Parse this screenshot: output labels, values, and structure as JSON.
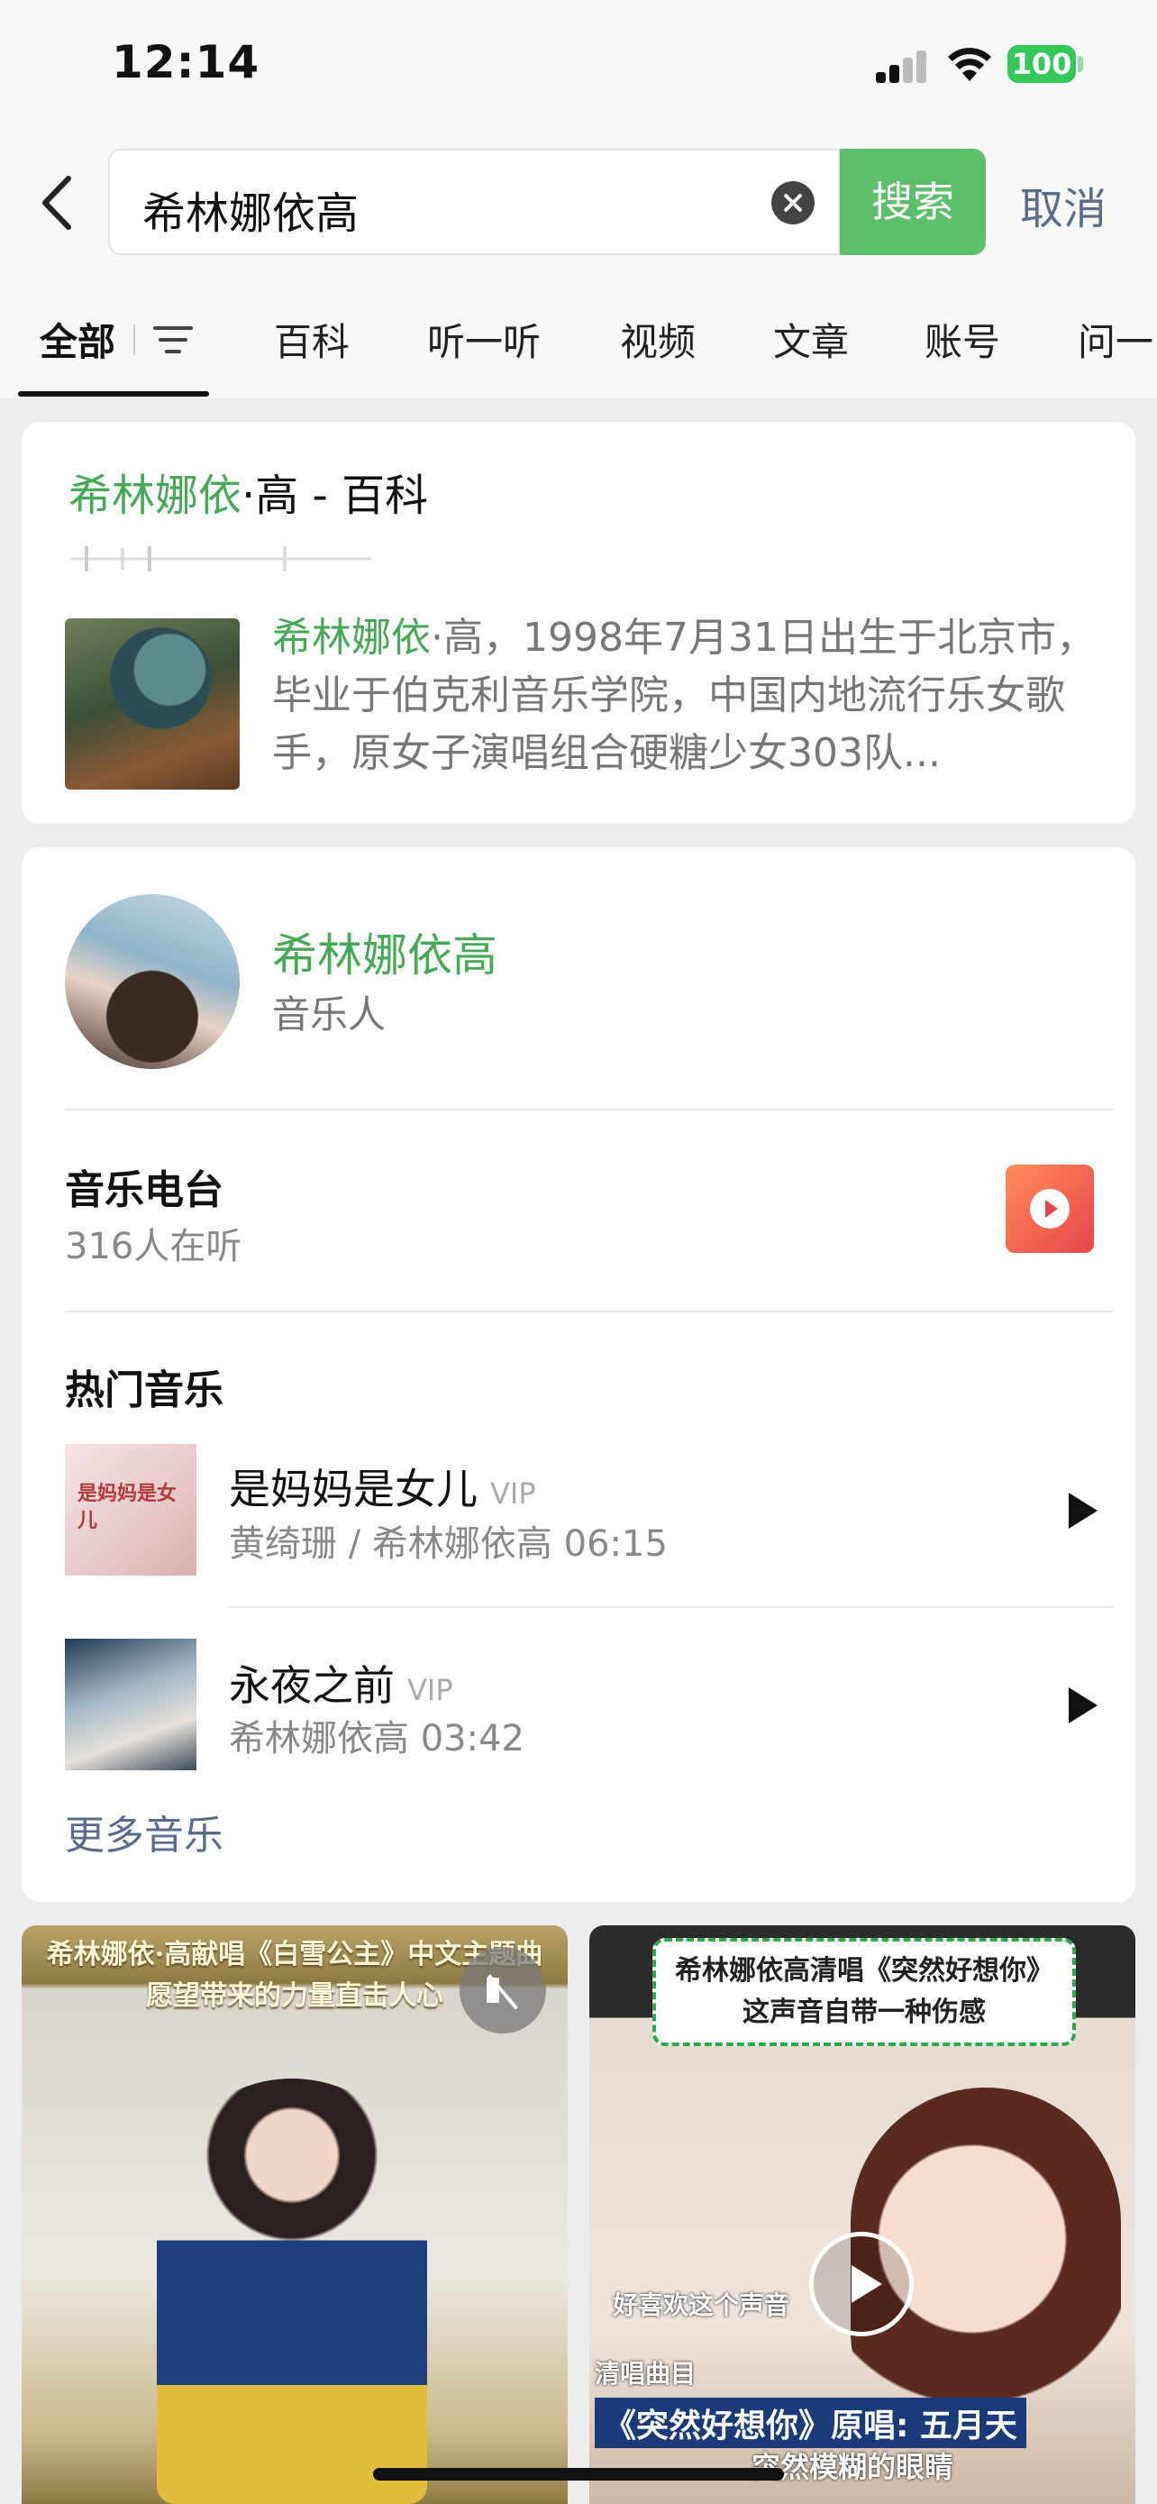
{
  "status_bar": {
    "time": "12:14",
    "battery": "100"
  },
  "search": {
    "query": "希林娜依高",
    "button": "搜索",
    "cancel": "取消"
  },
  "tabs": [
    "全部",
    "百科",
    "听一听",
    "视频",
    "文章",
    "账号",
    "问一"
  ],
  "baike": {
    "title_highlight": "希林娜依",
    "title_rest": "·高 - 百科",
    "desc_highlight": "希林娜依",
    "desc_rest": "·高，1998年7月31日出生于北京市，毕业于伯克利音乐学院，中国内地流行乐女歌手，原女子演唱组合硬糖少女303队..."
  },
  "person": {
    "name": "希林娜依高",
    "role": "音乐人"
  },
  "radio": {
    "title": "音乐电台",
    "listeners": "316人在听"
  },
  "hot_music": {
    "title": "热门音乐",
    "songs": [
      {
        "title": "是妈妈是女儿",
        "vip": "VIP",
        "meta": "黄绮珊 / 希林娜依高  06:15",
        "thumb_text": "是妈妈是女儿"
      },
      {
        "title": "永夜之前",
        "vip": "VIP",
        "meta": "希林娜依高  03:42"
      }
    ],
    "more": "更多音乐"
  },
  "videos": [
    {
      "caption_line1": "希林娜依·高献唱《白雪公主》中文主题曲",
      "caption_line2": "愿望带来的力量直击人心"
    },
    {
      "caption_line1": "希林娜依高清唱《突然好想你》",
      "caption_line2": "这声音自带一种伤感",
      "subtitle1": "好喜欢这个声音",
      "subtitle2": "清唱曲目",
      "subtitle3": "《突然好想你》原唱: 五月天",
      "subtitle4": "突然模糊的眼睛"
    }
  ],
  "colors": {
    "accent_green": "#45a956",
    "search_button": "#5dbf6b",
    "link_blue": "#5a6b8c"
  }
}
